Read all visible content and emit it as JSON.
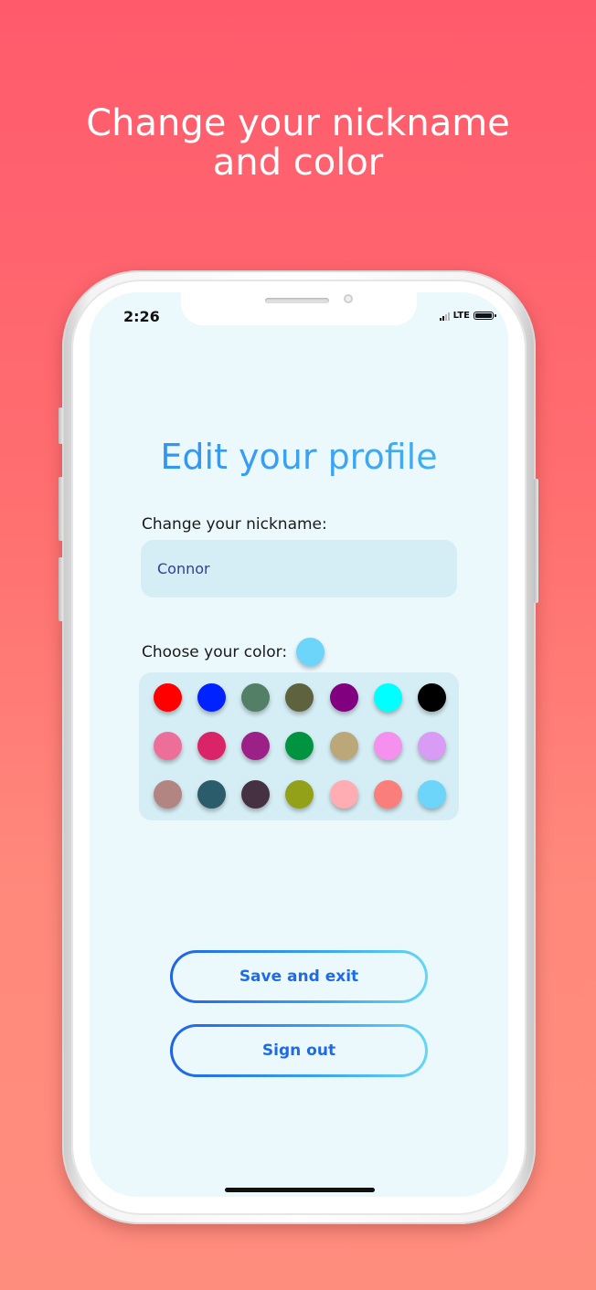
{
  "headline": {
    "line1": "Change your nickname",
    "line2": "and color"
  },
  "status_bar": {
    "time": "2:26",
    "network": "LTE"
  },
  "profile": {
    "title": "Edit your profile",
    "nickname_label": "Change your nickname:",
    "nickname_value": "Connor",
    "color_label": "Choose your color:",
    "selected_color": "#6dd5fa"
  },
  "palette": [
    [
      "#ff0000",
      "#0022ff",
      "#527f66",
      "#5f623f",
      "#800080",
      "#00ffff",
      "#000000"
    ],
    [
      "#ee6e9a",
      "#d92467",
      "#9c2186",
      "#009440",
      "#bca779",
      "#f590ee",
      "#d99cf4"
    ],
    [
      "#b28482",
      "#2b5c6c",
      "#453141",
      "#92a118",
      "#ffadb2",
      "#fa7f7c",
      "#6dd5fa"
    ]
  ],
  "actions": {
    "save_label": "Save and exit",
    "signout_label": "Sign out"
  },
  "colors": {
    "background_top": "#ff5a6c",
    "background_bottom": "#ff8d7e",
    "screen": "#ebf8fc",
    "field": "#d5edf4",
    "accent": "#1f6be6"
  }
}
